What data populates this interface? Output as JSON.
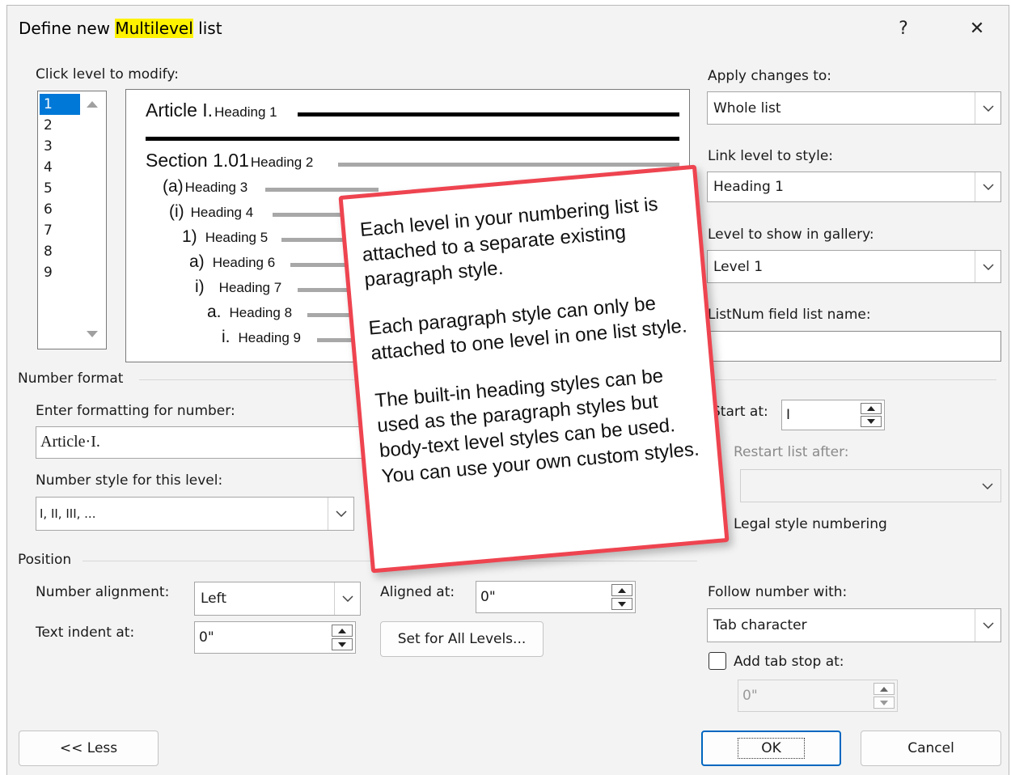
{
  "dialog": {
    "title_prefix": "Define new ",
    "title_highlight": "Multilevel",
    "title_suffix": " list",
    "help_label": "?",
    "close_label": "✕"
  },
  "levels": {
    "label": "Click level to modify:",
    "items": [
      "1",
      "2",
      "3",
      "4",
      "5",
      "6",
      "7",
      "8",
      "9"
    ],
    "selected": "1"
  },
  "preview": {
    "lines": [
      {
        "num": "Article I.",
        "heading": "Heading 1"
      },
      {
        "num": "Section 1.01",
        "heading": "Heading 2"
      },
      {
        "num": "(a)",
        "heading": "Heading 3"
      },
      {
        "num": "(i)",
        "heading": "Heading 4"
      },
      {
        "num": "1)",
        "heading": "Heading 5"
      },
      {
        "num": "a)",
        "heading": "Heading 6"
      },
      {
        "num": "i)",
        "heading": "Heading 7"
      },
      {
        "num": "a.",
        "heading": "Heading 8"
      },
      {
        "num": "i.",
        "heading": "Heading 9"
      }
    ]
  },
  "right_panel": {
    "apply_label": "Apply changes to:",
    "apply_value": "Whole list",
    "link_label": "Link level to style:",
    "link_value": "Heading 1",
    "gallery_label": "Level to show in gallery:",
    "gallery_value": "Level 1",
    "listnum_label": "ListNum field list name:",
    "listnum_value": "",
    "start_at_label": "Start at:",
    "start_at_value": "I",
    "restart_label": "Restart list after:",
    "legal_label": "Legal style numbering"
  },
  "number_format": {
    "group_label": "Number format",
    "enter_label": "Enter formatting for number:",
    "enter_value": "Article·I.",
    "style_label": "Number style for this level:",
    "style_value": "I, II, III, ..."
  },
  "position": {
    "group_label": "Position",
    "alignment_label": "Number alignment:",
    "alignment_value": "Left",
    "aligned_at_label": "Aligned at:",
    "aligned_at_value": "0\"",
    "indent_label": "Text indent at:",
    "indent_value": "0\"",
    "set_all_label": "Set for All Levels...",
    "follow_label": "Follow number with:",
    "follow_value": "Tab character",
    "tab_stop_label": "Add tab stop at:",
    "tab_stop_value": "0\""
  },
  "buttons": {
    "less_label": "<< Less",
    "ok_label": "OK",
    "cancel_label": "Cancel"
  },
  "callout": {
    "p1": "Each level in your numbering list is attached to a separate existing paragraph style.",
    "p2": "Each paragraph style can only be attached to one level in one list style.",
    "p3": "The built-in heading styles can be used as the paragraph styles but body-text level styles can be used. You can use your own custom styles."
  },
  "colors": {
    "callout_border": "#ee4450",
    "title_highlight": "#fff200",
    "selected_level": "#0078d7",
    "default_button": "#0067c0"
  }
}
